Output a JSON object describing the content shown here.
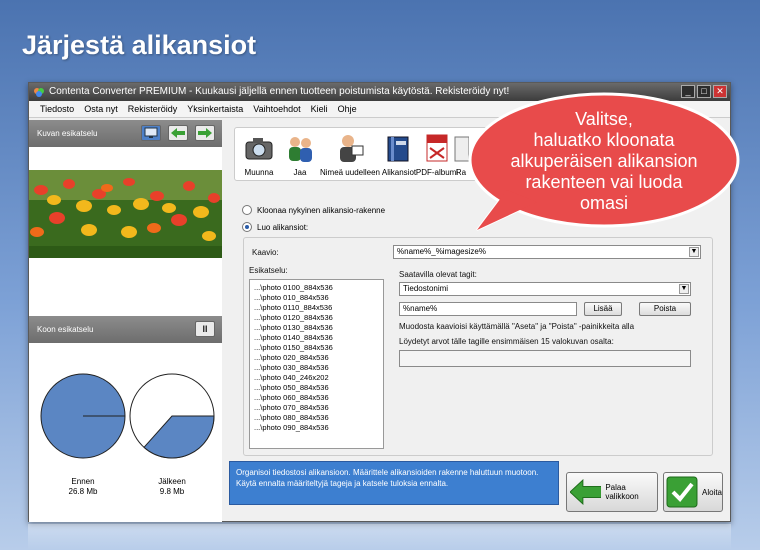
{
  "page_title": "Järjestä alikansiot",
  "window": {
    "title": "Contenta Converter PREMIUM  - Kuukausi jäljellä ennen tuotteen poistumista käytöstä. Rekisteröidy nyt!",
    "controls": [
      "_",
      "□",
      "✕"
    ]
  },
  "menu": [
    "Tiedosto",
    "Osta nyt",
    "Rekisteröidy",
    "Yksinkertaista",
    "Vaihtoehdot",
    "Kieli",
    "Ohje"
  ],
  "left_panel": {
    "image_preview_label": "Kuvan esikatselu",
    "size_preview_label": "Koon esikatselu",
    "pause_symbol": "II",
    "before": {
      "label": "Ennen",
      "size": "26.8 Mb",
      "fraction": 1.0
    },
    "after": {
      "label": "Jälkeen",
      "size": "9.8 Mb",
      "fraction": 0.366
    }
  },
  "tools": [
    {
      "label": "Muunna",
      "icon": "camera-icon"
    },
    {
      "label": "Jaa",
      "icon": "people-icon"
    },
    {
      "label": "Nimeä uudelleen",
      "icon": "rename-person-icon"
    },
    {
      "label": "Alikansiot",
      "icon": "folder-book-icon"
    },
    {
      "label": "PDF-albumi",
      "icon": "pdf-icon"
    },
    {
      "label": "Ra",
      "icon": "report-icon"
    }
  ],
  "options": {
    "clone": "Kloonaa nykyinen alikansio-rakenne",
    "create": "Luo alikansiot:"
  },
  "form": {
    "pattern_label": "Kaavio:",
    "pattern_value": "%name%_%imagesize%",
    "preview_label": "Esikatselu:",
    "preview_items": [
      "...\\photo 0100_884x536",
      "...\\photo 010_884x536",
      "...\\photo 0110_884x536",
      "...\\photo 0120_884x536",
      "...\\photo 0130_884x536",
      "...\\photo 0140_884x536",
      "...\\photo 0150_884x536",
      "...\\photo 020_884x536",
      "...\\photo 030_884x536",
      "...\\photo 040_246x202",
      "...\\photo 050_884x536",
      "...\\photo 060_884x536",
      "...\\photo 070_884x536",
      "...\\photo 080_884x536",
      "...\\photo 090_884x536"
    ],
    "tags_label": "Saatavilla olevat tagit:",
    "tag_selected": "Tiedostonimi",
    "tag_value": "%name%",
    "add_button": "Lisää",
    "remove_button": "Poista",
    "help_text": "Muodosta kaavioisi käyttämällä \"Aseta\" ja \"Poista\" -painikkeita alla",
    "found_values_label": "Löydetyt arvot tälle tagille ensimmäisen 15 valokuvan osalta:"
  },
  "status_text": "Organisoi tiedostosi alikansioon. Määrittele alikansioiden rakenne haluttuun muotoon. Käytä ennalta määriteltyjä tageja ja katsele tuloksia ennalta.",
  "back_button": "Palaa valikkoon",
  "start_button": "Aloita",
  "callout": [
    "Valitse,",
    "haluatko kloonata",
    "alkuperäisen alikansion",
    "rakenteen vai luoda",
    "omasi"
  ],
  "colors": {
    "accent_blue": "#3d7fd0",
    "pie_fill": "#5b86c3",
    "callout_red": "#e84b4b",
    "green": "#3aa035"
  }
}
